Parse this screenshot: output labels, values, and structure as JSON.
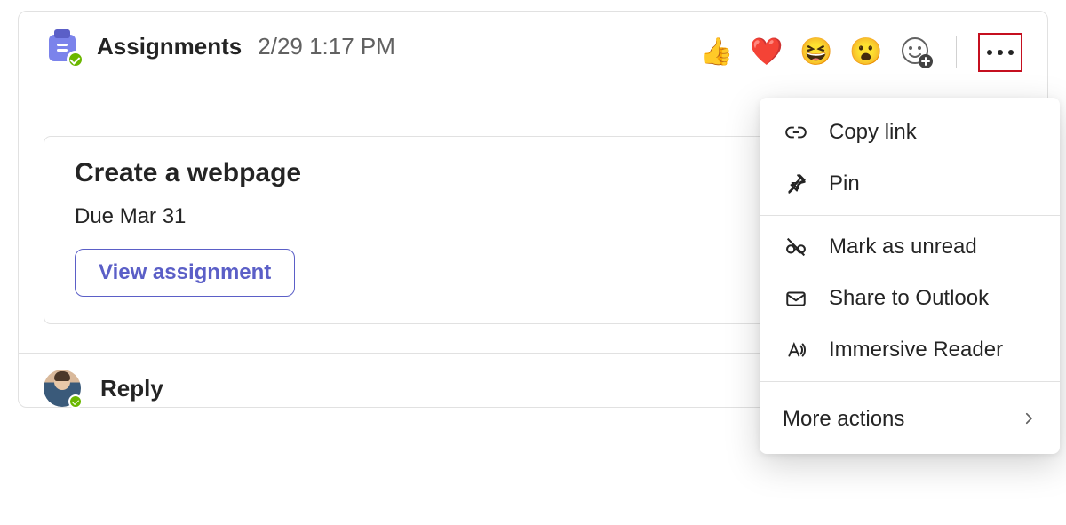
{
  "message": {
    "sender": "Assignments",
    "timestamp": "2/29 1:17 PM",
    "assignment": {
      "title": "Create a webpage",
      "due_text": "Due Mar 31",
      "view_button_label": "View assignment"
    },
    "reply_label": "Reply"
  },
  "reactions": {
    "like": "👍",
    "heart": "❤️",
    "laugh": "😆",
    "surprised": "😮"
  },
  "context_menu": {
    "copy_link": "Copy link",
    "pin": "Pin",
    "mark_unread": "Mark as unread",
    "share_outlook": "Share to Outlook",
    "immersive_reader": "Immersive Reader",
    "more_actions": "More actions"
  },
  "colors": {
    "accent": "#5B5FC7",
    "highlight_border": "#c50f1f",
    "presence_available": "#6bb700"
  }
}
